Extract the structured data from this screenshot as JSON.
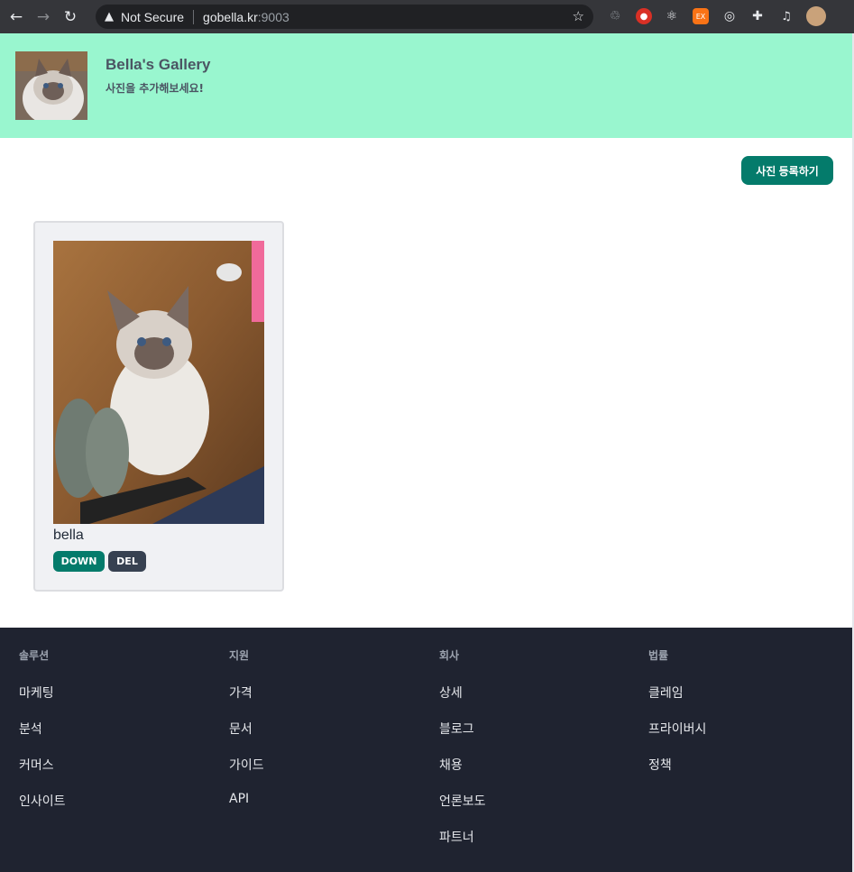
{
  "browser": {
    "security_label": "Not Secure",
    "host": "gobella.kr",
    "port": ":9003"
  },
  "header": {
    "title": "Bella's Gallery",
    "subtitle": "사진을 추가해보세요!"
  },
  "main": {
    "upload_label": "사진 등록하기",
    "cards": [
      {
        "caption": "bella",
        "down_label": "DOWN",
        "del_label": "DEL"
      }
    ]
  },
  "footer": {
    "columns": [
      {
        "heading": "솔루션",
        "links": [
          "마케팅",
          "분석",
          "커머스",
          "인사이트"
        ]
      },
      {
        "heading": "지원",
        "links": [
          "가격",
          "문서",
          "가이드",
          "API"
        ]
      },
      {
        "heading": "회사",
        "links": [
          "상세",
          "블로그",
          "채용",
          "언론보도",
          "파트너"
        ]
      },
      {
        "heading": "법률",
        "links": [
          "클레임",
          "프라이버시",
          "정책"
        ]
      }
    ]
  },
  "colors": {
    "header_bg": "#99f6cf",
    "accent": "#047b6b",
    "footer_bg": "#1f2330"
  }
}
